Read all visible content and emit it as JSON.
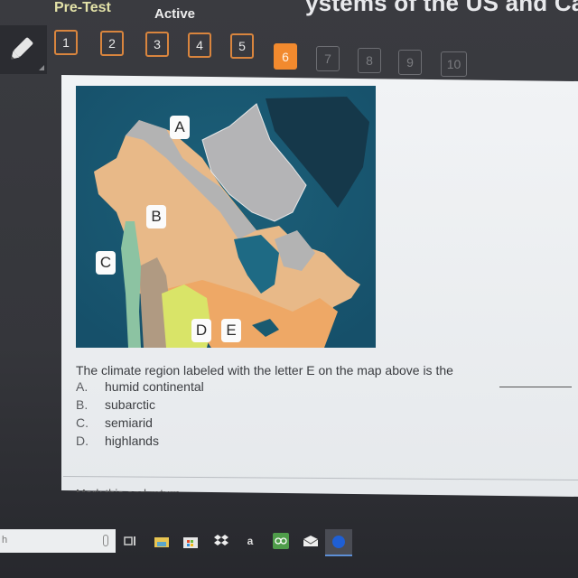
{
  "header": {
    "title_fragment": "ystems of the US and Can",
    "section": "Pre-Test",
    "status": "Active"
  },
  "question_nav": {
    "current": 6,
    "items": [
      {
        "label": "1",
        "state": "answered"
      },
      {
        "label": "2",
        "state": "answered"
      },
      {
        "label": "3",
        "state": "answered"
      },
      {
        "label": "4",
        "state": "answered"
      },
      {
        "label": "5",
        "state": "answered"
      },
      {
        "label": "6",
        "state": "current"
      },
      {
        "label": "7",
        "state": "locked"
      },
      {
        "label": "8",
        "state": "locked"
      },
      {
        "label": "9",
        "state": "locked"
      },
      {
        "label": "10",
        "state": "locked"
      }
    ]
  },
  "map": {
    "labels": [
      "A",
      "B",
      "C",
      "D",
      "E"
    ]
  },
  "question": {
    "text": "The climate region labeled with the letter E on the map above is the",
    "options": [
      {
        "letter": "A.",
        "text": "humid continental"
      },
      {
        "letter": "B.",
        "text": "subarctic"
      },
      {
        "letter": "C.",
        "text": "semiarid"
      },
      {
        "letter": "D.",
        "text": "highlands"
      }
    ],
    "next_cut_text": "Mark this and return"
  },
  "taskbar": {
    "search_placeholder": "h",
    "icons": [
      "task-view",
      "file-explorer",
      "store",
      "dropbox",
      "amazon",
      "tripadvisor",
      "mail",
      "edge"
    ]
  },
  "colors": {
    "accent": "#f28a2e",
    "answered_border": "#d9853e",
    "locked_border": "#6d6e73"
  }
}
